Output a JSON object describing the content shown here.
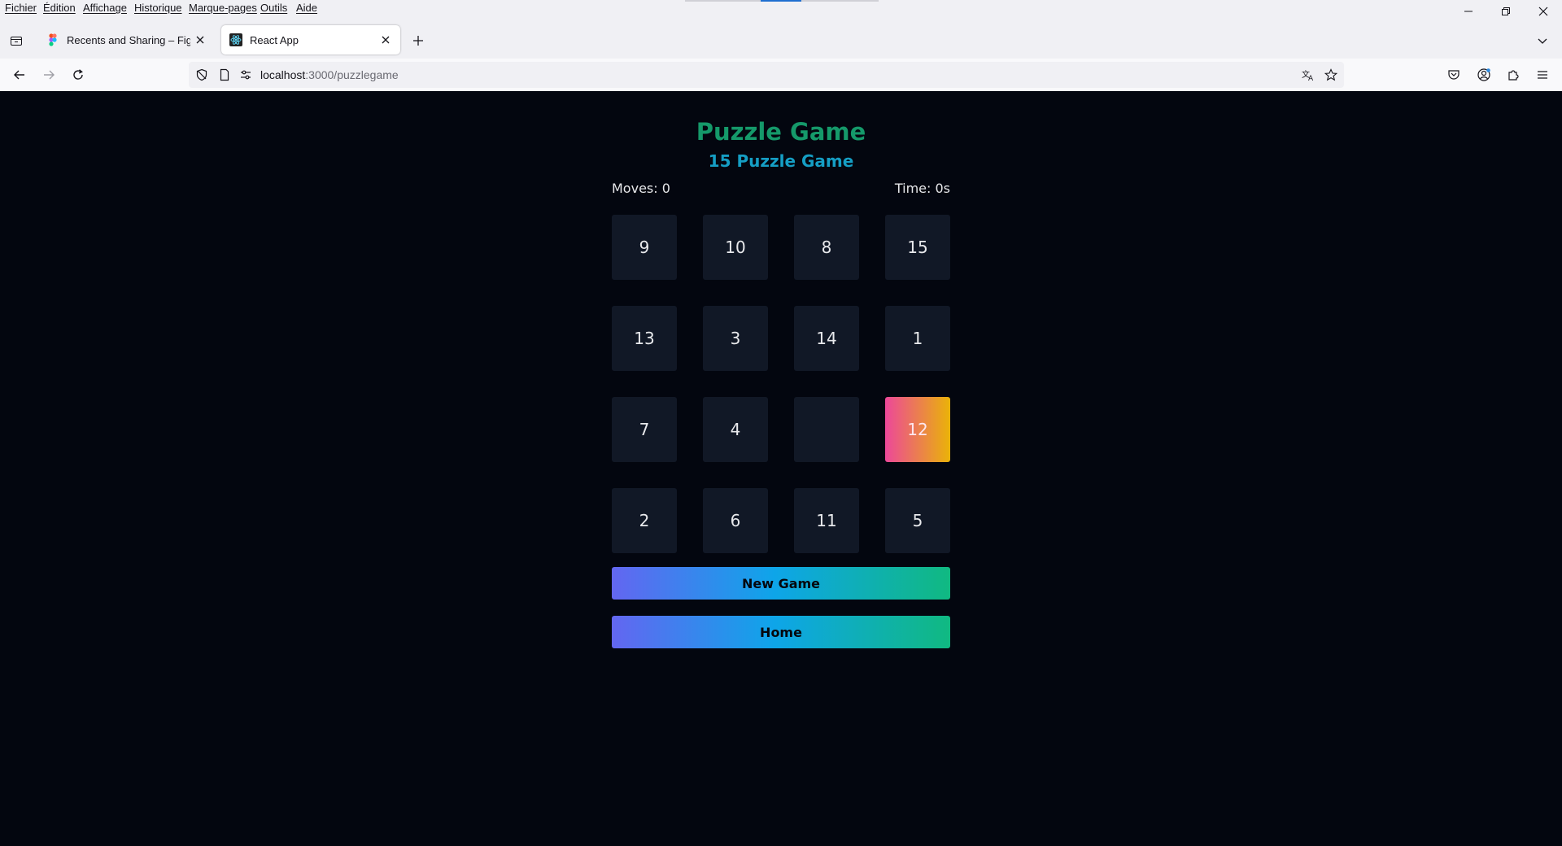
{
  "browser": {
    "menu": [
      "Fichier",
      "Édition",
      "Affichage",
      "Historique",
      "Marque-pages",
      "Outils",
      "Aide"
    ],
    "tabs": [
      {
        "title": "Recents and Sharing – Figma",
        "icon": "figma-icon",
        "active": false
      },
      {
        "title": "React App",
        "icon": "react-icon",
        "active": true
      }
    ],
    "url": {
      "host": "localhost",
      "path": ":3000/puzzlegame"
    }
  },
  "game": {
    "title": "Puzzle Game",
    "subtitle": "15 Puzzle Game",
    "moves_label": "Moves: 0",
    "time_label": "Time: 0s",
    "tiles": [
      "9",
      "10",
      "8",
      "15",
      "13",
      "3",
      "14",
      "1",
      "7",
      "4",
      "",
      "12",
      "2",
      "6",
      "11",
      "5"
    ],
    "highlighted_tile": "12",
    "new_game_label": "New Game",
    "home_label": "Home"
  },
  "colors": {
    "background": "#03060f",
    "title": "#15996a",
    "subtitle": "#159ec4",
    "tile": "#111826",
    "highlight_gradient": [
      "#ec4899",
      "#eab308"
    ],
    "button_gradient": [
      "#6366f1",
      "#0ea5e9",
      "#10b981"
    ]
  }
}
